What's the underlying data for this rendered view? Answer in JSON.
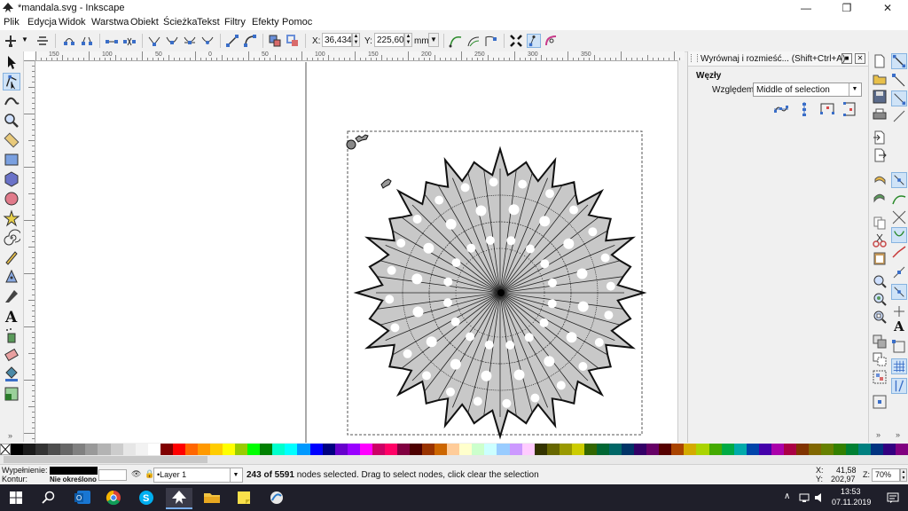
{
  "window": {
    "title": "*mandala.svg - Inkscape",
    "controls": [
      "minimize",
      "maximize",
      "close"
    ]
  },
  "menu": [
    "Plik",
    "Edycja",
    "Widok",
    "Warstwa",
    "Obiekt",
    "Ścieżka",
    "Tekst",
    "Filtry",
    "Efekty",
    "Pomoc"
  ],
  "toolcontrols": {
    "x_label": "X:",
    "x_value": "36,434",
    "y_label": "Y:",
    "y_value": "225,600",
    "unit": "mm"
  },
  "dock": {
    "title": "Wyrównaj i rozmieść... (Shift+Ctrl+A)",
    "section": "Węzły",
    "relative_label": "Względem:",
    "relative_value": "Middle of selection"
  },
  "palette_colors": [
    "#000000",
    "#1a1a1a",
    "#333333",
    "#4d4d4d",
    "#666666",
    "#808080",
    "#999999",
    "#b3b3b3",
    "#cccccc",
    "#e6e6e6",
    "#f2f2f2",
    "#ffffff",
    "#800000",
    "#ff0000",
    "#ff6600",
    "#ff9900",
    "#ffcc00",
    "#ffff00",
    "#99cc00",
    "#00ff00",
    "#008000",
    "#00ffcc",
    "#00ffff",
    "#0099ff",
    "#0000ff",
    "#000080",
    "#6600cc",
    "#9900ff",
    "#ff00ff",
    "#cc0066",
    "#ff0066",
    "#800040",
    "#4d0000",
    "#993300",
    "#cc6600",
    "#ffcc99",
    "#ffffcc",
    "#ccffcc",
    "#ccffff",
    "#99ccff",
    "#cc99ff",
    "#ffccff",
    "#333300",
    "#666600",
    "#999900",
    "#cccc00",
    "#336600",
    "#006633",
    "#006666",
    "#003366",
    "#330066",
    "#660066",
    "#550000",
    "#aa4400",
    "#d4aa00",
    "#aad400",
    "#44aa00",
    "#00aa44",
    "#00aaaa",
    "#0044aa",
    "#4400aa",
    "#aa00aa",
    "#aa0044",
    "#803300",
    "#806600",
    "#668000",
    "#338000",
    "#008033",
    "#008080",
    "#003380",
    "#330080",
    "#800080"
  ],
  "status": {
    "fill_label": "Wypełnienie:",
    "stroke_label": "Kontur:",
    "stroke_value": "Nie określono",
    "layer_value": "•Layer 1",
    "message_bold": "243 of 5591",
    "message_rest": " nodes selected. Drag to select nodes, click clear the selection",
    "x_label": "X:",
    "x_value": "41,58",
    "y_label": "Y:",
    "y_value": "202,97",
    "zoom_label": "Z:",
    "zoom_value": "70%"
  },
  "ruler_labels": [
    "150",
    "100",
    "50",
    "0",
    "50",
    "100",
    "150",
    "200",
    "250",
    "300",
    "350"
  ],
  "taskbar": {
    "time": "13:53",
    "date": "07.11.2019"
  }
}
